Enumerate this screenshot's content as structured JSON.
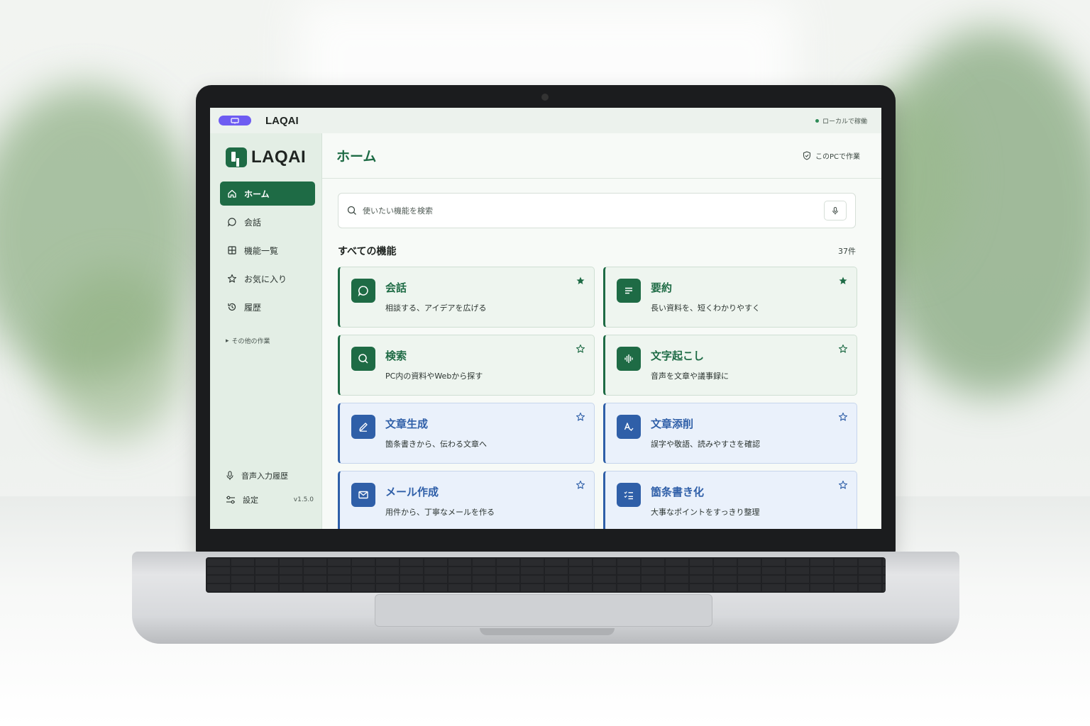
{
  "titlebar": {
    "app_name": "LAQAI",
    "status": "ローカルで稼働"
  },
  "sidebar": {
    "logo": "LAQAI",
    "items": [
      {
        "label": "ホーム",
        "icon": "home-icon",
        "active": true
      },
      {
        "label": "会話",
        "icon": "chat-icon",
        "active": false
      },
      {
        "label": "機能一覧",
        "icon": "grid-icon",
        "active": false
      },
      {
        "label": "お気に入り",
        "icon": "star-icon",
        "active": false
      },
      {
        "label": "履歴",
        "icon": "history-icon",
        "active": false
      }
    ],
    "other_tasks": "その他の作業",
    "voice_history": "音声入力履歴",
    "settings": "設定",
    "version": "v1.5.0"
  },
  "main": {
    "title": "ホーム",
    "work_badge": "このPCで作業",
    "search_placeholder": "使いたい機能を検索",
    "section_title": "すべての機能",
    "section_count": "37件",
    "cards": [
      {
        "title": "会話",
        "desc": "相談する、アイデアを広げる",
        "icon": "chat-icon",
        "favorite": true,
        "color": "green"
      },
      {
        "title": "要約",
        "desc": "長い資料を、短くわかりやすく",
        "icon": "lines-icon",
        "favorite": true,
        "color": "green"
      },
      {
        "title": "検索",
        "desc": "PC内の資料やWebから探す",
        "icon": "search-icon",
        "favorite": false,
        "color": "green"
      },
      {
        "title": "文字起こし",
        "desc": "音声を文章や議事録に",
        "icon": "waveform-icon",
        "favorite": false,
        "color": "green"
      },
      {
        "title": "文章生成",
        "desc": "箇条書きから、伝わる文章へ",
        "icon": "pen-icon",
        "favorite": false,
        "color": "blue"
      },
      {
        "title": "文章添削",
        "desc": "誤字や敬語、読みやすさを確認",
        "icon": "text-check-icon",
        "favorite": false,
        "color": "blue"
      },
      {
        "title": "メール作成",
        "desc": "用件から、丁寧なメールを作る",
        "icon": "mail-icon",
        "favorite": false,
        "color": "blue"
      },
      {
        "title": "箇条書き化",
        "desc": "大事なポイントをすっきり整理",
        "icon": "checklist-icon",
        "favorite": false,
        "color": "blue"
      }
    ]
  },
  "colors": {
    "primary_green": "#1e6b45",
    "primary_blue": "#2f5fa8",
    "titlebar_pill": "#6e5cf2"
  }
}
